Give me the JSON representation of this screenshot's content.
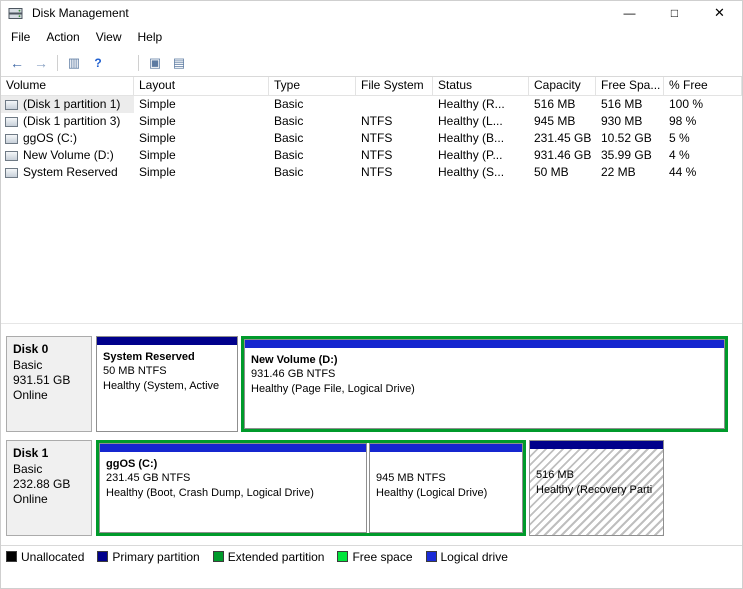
{
  "window": {
    "title": "Disk Management",
    "controls": {
      "minimize": "—",
      "maximize": "□",
      "close": "✕"
    }
  },
  "menubar": {
    "items": [
      "File",
      "Action",
      "View",
      "Help"
    ]
  },
  "toolbar": {
    "back_glyph": "←",
    "forward_glyph": "→",
    "console_tree_glyph": "▥",
    "help_glyph": "?",
    "action_pane_glyph": "▣",
    "details_glyph": "▤"
  },
  "volume_table": {
    "columns": [
      "Volume",
      "Layout",
      "Type",
      "File System",
      "Status",
      "Capacity",
      "Free Spa...",
      "% Free"
    ],
    "rows": [
      {
        "volume": "(Disk 1 partition 1)",
        "layout": "Simple",
        "type": "Basic",
        "file_system": "",
        "status": "Healthy (R...",
        "capacity": "516 MB",
        "free_space": "516 MB",
        "pct_free": "100 %"
      },
      {
        "volume": "(Disk 1 partition 3)",
        "layout": "Simple",
        "type": "Basic",
        "file_system": "NTFS",
        "status": "Healthy (L...",
        "capacity": "945 MB",
        "free_space": "930 MB",
        "pct_free": "98 %"
      },
      {
        "volume": "ggOS (C:)",
        "layout": "Simple",
        "type": "Basic",
        "file_system": "NTFS",
        "status": "Healthy (B...",
        "capacity": "231.45 GB",
        "free_space": "10.52 GB",
        "pct_free": "5 %"
      },
      {
        "volume": "New Volume (D:)",
        "layout": "Simple",
        "type": "Basic",
        "file_system": "NTFS",
        "status": "Healthy (P...",
        "capacity": "931.46 GB",
        "free_space": "35.99 GB",
        "pct_free": "4 %"
      },
      {
        "volume": "System Reserved",
        "layout": "Simple",
        "type": "Basic",
        "file_system": "NTFS",
        "status": "Healthy (S...",
        "capacity": "50 MB",
        "free_space": "22 MB",
        "pct_free": "44 %"
      }
    ]
  },
  "disks": [
    {
      "name": "Disk 0",
      "type": "Basic",
      "size": "931.51 GB",
      "status": "Online",
      "partitions": [
        {
          "title": "System Reserved",
          "size_line": "50 MB NTFS",
          "status_line": "Healthy (System, Active",
          "strip_color": "#00008b"
        },
        {
          "title": "New Volume  (D:)",
          "size_line": "931.46 GB NTFS",
          "status_line": "Healthy (Page File, Logical Drive)",
          "strip_color": "#1526cf"
        }
      ]
    },
    {
      "name": "Disk 1",
      "type": "Basic",
      "size": "232.88 GB",
      "status": "Online",
      "partitions": [
        {
          "title": "ggOS  (C:)",
          "size_line": "231.45 GB NTFS",
          "status_line": "Healthy (Boot, Crash Dump, Logical Drive)",
          "strip_color": "#1526cf"
        },
        {
          "title": "",
          "size_line": "945 MB NTFS",
          "status_line": "Healthy (Logical Drive)",
          "strip_color": "#1526cf"
        },
        {
          "title": "",
          "size_line": "516 MB",
          "status_line": "Healthy (Recovery Parti",
          "strip_color": "#00008b"
        }
      ]
    }
  ],
  "legend": {
    "items": [
      {
        "label": "Unallocated",
        "color": "#000000"
      },
      {
        "label": "Primary partition",
        "color": "#00008b"
      },
      {
        "label": "Extended partition",
        "color": "#009a2b"
      },
      {
        "label": "Free space",
        "color": "#00e53c"
      },
      {
        "label": "Logical drive",
        "color": "#1b2bd6"
      }
    ]
  },
  "colors": {
    "extended_border": "#009a2b"
  }
}
